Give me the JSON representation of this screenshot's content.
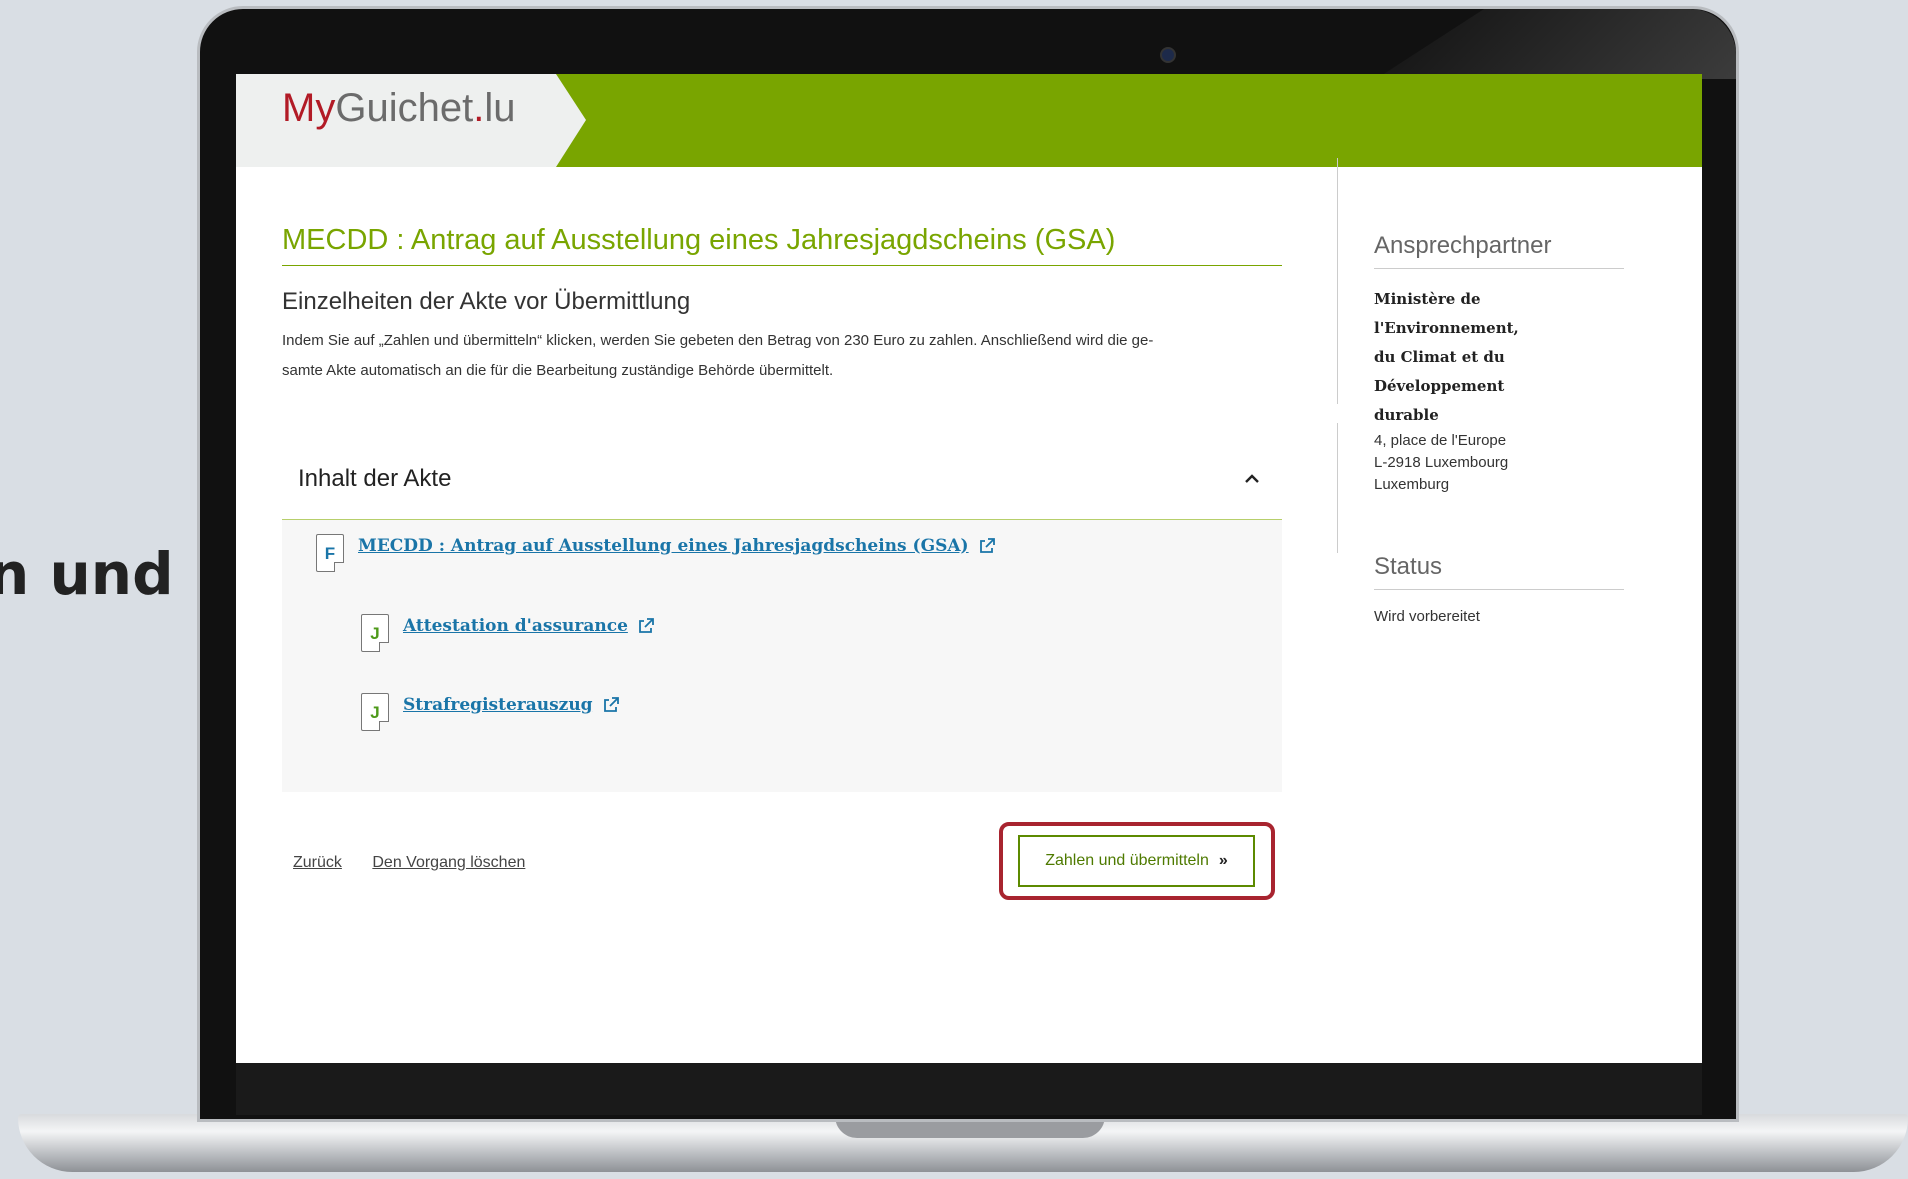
{
  "side_caption": "n und",
  "brand": {
    "my": "My",
    "guichet": "Guichet",
    "dot": ".",
    "lu": "lu"
  },
  "main": {
    "title": "MECDD : Antrag auf Ausstellung eines Jahresjagdscheins (GSA)",
    "subtitle": "Einzelheiten der Akte vor Übermittlung",
    "description_line1": "Indem Sie auf „Zahlen und übermitteln“ klicken, werden Sie gebeten den Betrag von 230 Euro zu zahlen. Anschließend wird die ge-",
    "description_line2": "samte Akte automatisch an die für die Bearbeitung zuständige Behörde übermittelt."
  },
  "accordion": {
    "title": "Inhalt der Akte",
    "chevron_icon": "chevron-up-icon",
    "documents": [
      {
        "letter": "F",
        "label": "MECDD : Antrag auf Ausstellung eines Jahresjagdscheins (GSA)",
        "letter_color": "#1a75a8"
      },
      {
        "letter": "J",
        "label": "Attestation d'assurance",
        "letter_color": "#4e9a1a"
      },
      {
        "letter": "J",
        "label": "Strafregisterauszug",
        "letter_color": "#4e9a1a"
      }
    ]
  },
  "footer": {
    "back_label": "Zurück",
    "delete_label": "Den Vorgang löschen",
    "submit_label": "Zahlen und übermitteln",
    "submit_icon": "double-chevron-right-icon"
  },
  "sidebar": {
    "contact_title": "Ansprechpartner",
    "org_line1": "Ministère de l'Environnement,",
    "org_line2": "du Climat et du Développement",
    "org_line3": "durable",
    "address_line1": "4, place de l'Europe",
    "address_line2": "L-2918 Luxembourg",
    "address_line3": "Luxemburg",
    "status_title": "Status",
    "status_value": "Wird vorbereitet"
  },
  "colors": {
    "brand_green": "#79a500",
    "brand_red": "#b21b26",
    "link_blue": "#1a75a8",
    "highlight_frame": "#a8242f"
  }
}
